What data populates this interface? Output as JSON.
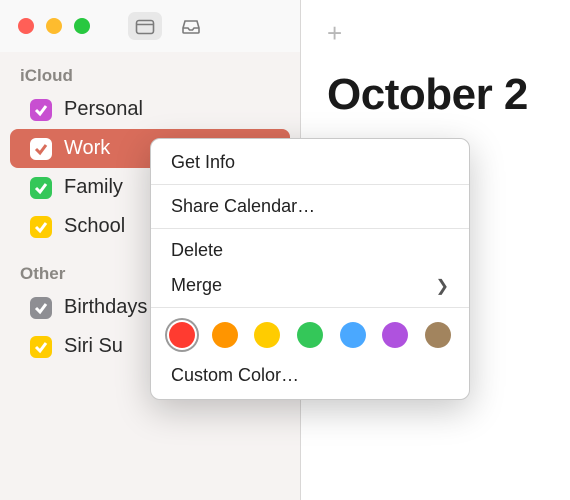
{
  "toolbar": {
    "calendar_icon": "calendar",
    "inbox_icon": "inbox",
    "add_icon": "+"
  },
  "main": {
    "title_visible": "October 2"
  },
  "sidebar": {
    "sections": [
      {
        "header": "iCloud",
        "items": [
          {
            "label": "Personal",
            "color": "#c84fd1",
            "checked": true,
            "selected": false
          },
          {
            "label": "Work",
            "color": "#d96d5b",
            "checked": true,
            "selected": true
          },
          {
            "label": "Family",
            "color": "#34c759",
            "checked": true,
            "selected": false
          },
          {
            "label": "School",
            "color": "#ffcc00",
            "checked": true,
            "selected": false
          }
        ]
      },
      {
        "header": "Other",
        "items": [
          {
            "label": "Birthdays",
            "color": "#8e8e93",
            "checked": true,
            "selected": false
          },
          {
            "label": "Siri Suggestions",
            "color": "#ffcc00",
            "checked": true,
            "selected": false,
            "label_visible": "Siri Su"
          }
        ]
      }
    ]
  },
  "context_menu": {
    "items": [
      {
        "label": "Get Info",
        "type": "item"
      },
      {
        "type": "separator"
      },
      {
        "label": "Share Calendar…",
        "type": "item"
      },
      {
        "type": "separator"
      },
      {
        "label": "Delete",
        "type": "item"
      },
      {
        "label": "Merge",
        "type": "submenu"
      },
      {
        "type": "separator"
      },
      {
        "type": "colors"
      },
      {
        "label": "Custom Color…",
        "type": "item"
      }
    ],
    "colors": [
      {
        "hex": "#ff3b30",
        "name": "red",
        "selected": true
      },
      {
        "hex": "#ff9500",
        "name": "orange",
        "selected": false
      },
      {
        "hex": "#ffcc00",
        "name": "yellow",
        "selected": false
      },
      {
        "hex": "#34c759",
        "name": "green",
        "selected": false
      },
      {
        "hex": "#4aa8ff",
        "name": "blue",
        "selected": false
      },
      {
        "hex": "#af52de",
        "name": "purple",
        "selected": false
      },
      {
        "hex": "#a2845e",
        "name": "brown",
        "selected": false
      }
    ]
  }
}
